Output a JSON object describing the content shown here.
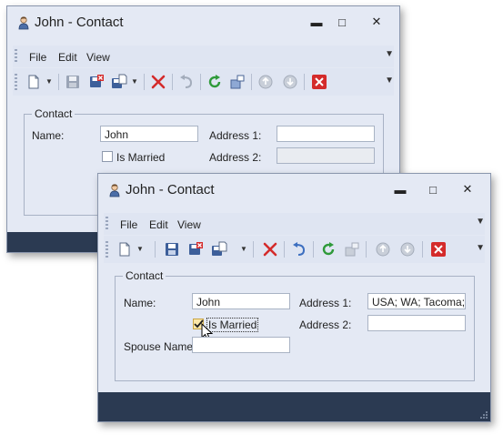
{
  "back_window": {
    "title": "John - Contact",
    "controls": {
      "minimize": "▬",
      "maximize": "□",
      "close": "✕"
    },
    "menu": [
      "File",
      "Edit",
      "View"
    ],
    "group_title": "Contact",
    "name_label": "Name:",
    "name_value": "John",
    "married_label": "Is Married",
    "address1_label": "Address 1:",
    "address1_value": "",
    "address2_label": "Address 2:",
    "address2_value": ""
  },
  "front_window": {
    "title": "John - Contact",
    "controls": {
      "minimize": "▬",
      "maximize": "□",
      "close": "✕"
    },
    "menu": [
      "File",
      "Edit",
      "View"
    ],
    "group_title": "Contact",
    "name_label": "Name:",
    "name_value": "John",
    "married_label": "Is Married",
    "married_checked": true,
    "spouse_label": "Spouse Name:",
    "spouse_value": "",
    "address1_label": "Address 1:",
    "address1_value": "USA; WA; Tacoma;",
    "address2_label": "Address 2:",
    "address2_value": ""
  },
  "glyphs": {
    "more": "▼",
    "dropdown": "▼"
  },
  "toolbar_icons": [
    "new-document-icon",
    "save-icon",
    "save-and-close-icon",
    "save-and-new-icon",
    "delete-icon",
    "undo-icon",
    "refresh-icon",
    "view-icon",
    "previous-icon",
    "next-icon",
    "close-icon"
  ],
  "colors": {
    "window_bg": "#e4e9f4",
    "statusbar": "#2b3a52",
    "delete_red": "#d42b2b",
    "refresh_green": "#2f9a3a",
    "check_fill": "#fbe7a8"
  }
}
